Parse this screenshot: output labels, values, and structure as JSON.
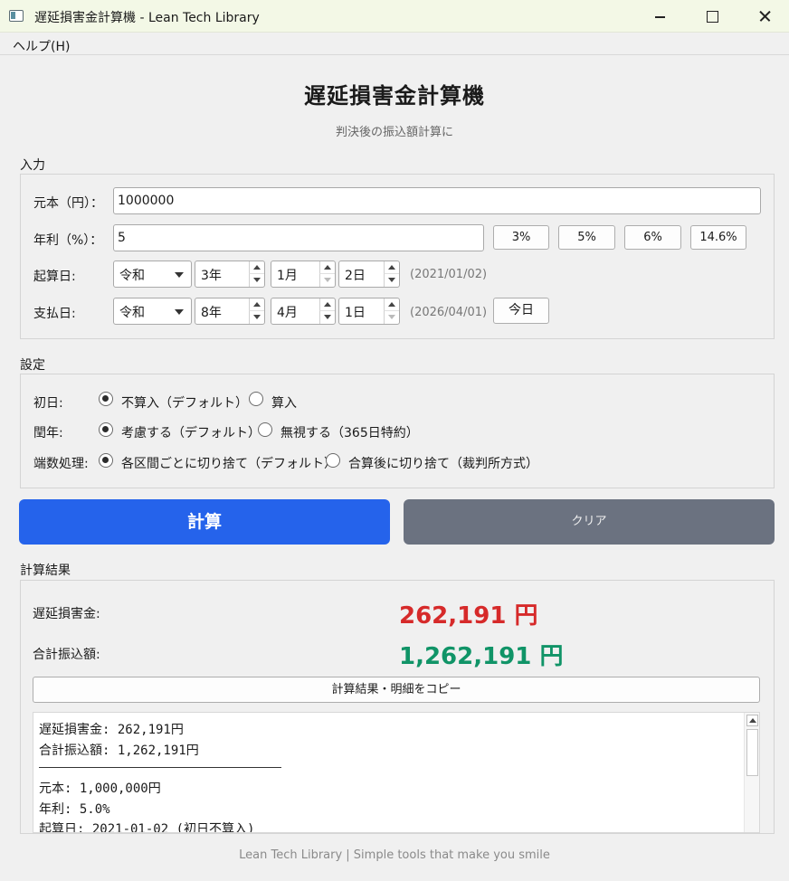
{
  "window": {
    "title": "遅延損害金計算機 - Lean Tech Library"
  },
  "menu": {
    "help": "ヘルプ(H)"
  },
  "header": {
    "title": "遅延損害金計算機",
    "subtitle": "判決後の振込額計算に"
  },
  "input": {
    "section_label": "入力",
    "principal_label": "元本（円）：",
    "principal_value": "1000000",
    "rate_label": "年利（%）：",
    "rate_value": "5",
    "rate_presets": [
      "3%",
      "5%",
      "6%",
      "14.6%"
    ],
    "start_label": "起算日:",
    "start_era": "令和",
    "start_year": "3年",
    "start_month": "1月",
    "start_day": "2日",
    "start_hint": "(2021/01/02)",
    "pay_label": "支払日:",
    "pay_era": "令和",
    "pay_year": "8年",
    "pay_month": "4月",
    "pay_day": "1日",
    "pay_hint": "(2026/04/01)",
    "today_button": "今日"
  },
  "settings": {
    "section_label": "設定",
    "first_day_label": "初日:",
    "first_day_options": [
      "不算入（デフォルト）",
      "算入"
    ],
    "first_day_selected": 0,
    "leap_label": "閏年:",
    "leap_options": [
      "考慮する（デフォルト）",
      "無視する（365日特約）"
    ],
    "leap_selected": 0,
    "rounding_label": "端数処理:",
    "rounding_options": [
      "各区間ごとに切り捨て（デフォルト）",
      "合算後に切り捨て（裁判所方式）"
    ],
    "rounding_selected": 0
  },
  "actions": {
    "calculate": "計算",
    "clear": "クリア"
  },
  "result": {
    "section_label": "計算結果",
    "damages_label": "遅延損害金:",
    "damages_value": "262,191 円",
    "total_label": "合計振込額:",
    "total_value": "1,262,191 円",
    "copy_button": "計算結果・明細をコピー",
    "detail_lines": [
      "遅延損害金: 262,191円",
      "合計振込額: 1,262,191円",
      "元本: 1,000,000円",
      "年利: 5.0%",
      "起算日: 2021-01-02 (初日不算入)"
    ]
  },
  "colors": {
    "primary_button": "#2563eb",
    "secondary_button": "#6b7280",
    "damages_text": "#d62a2a",
    "total_text": "#109467"
  },
  "footer": {
    "text": "Lean Tech Library | Simple tools that make you smile"
  }
}
